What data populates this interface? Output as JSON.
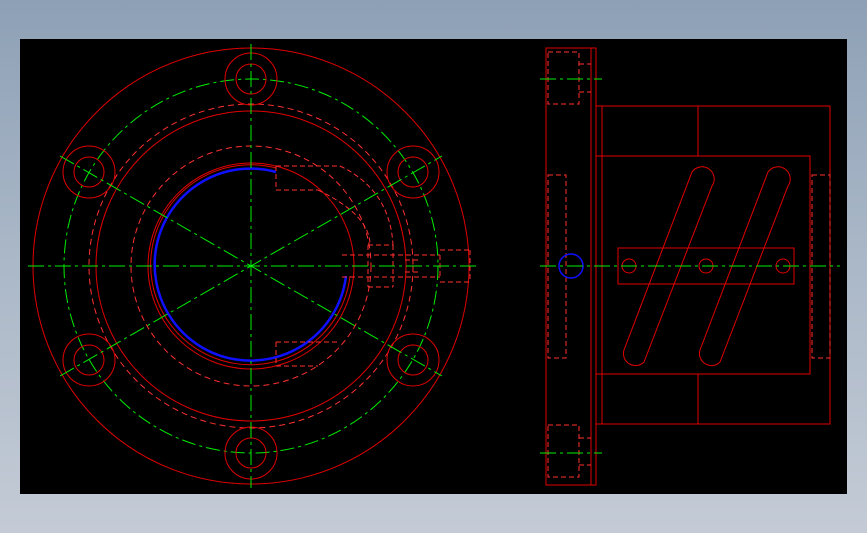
{
  "drawing": {
    "background": "#000000",
    "colors": {
      "outline": "#ff0000",
      "hidden": "#ff2a2a",
      "center": "#00ff00",
      "highlight": "#0000ff"
    },
    "views": [
      "front-view",
      "side-view"
    ]
  }
}
